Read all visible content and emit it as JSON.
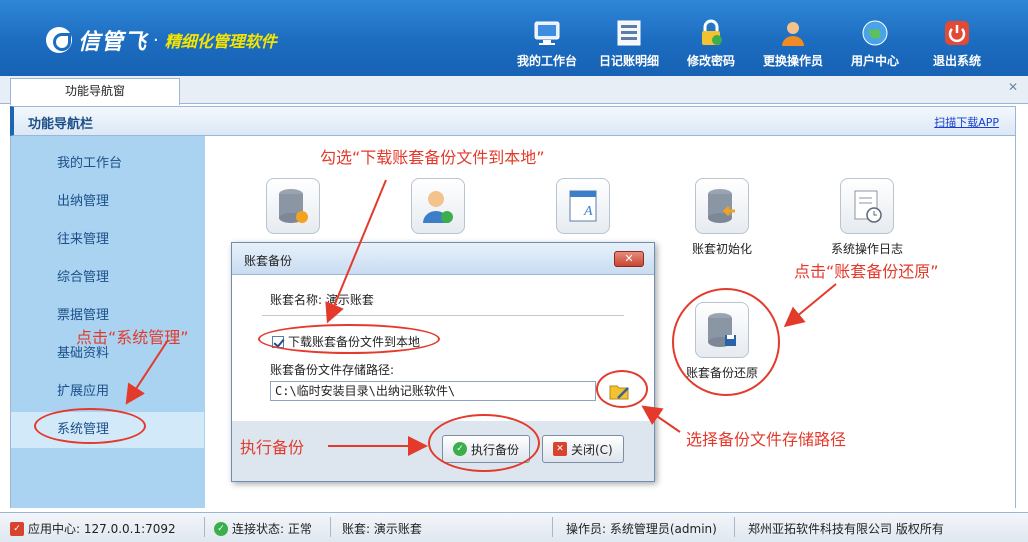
{
  "header": {
    "brand": "信管飞",
    "slogan": "精细化管理软件",
    "nav": [
      {
        "label": "我的工作台",
        "icon": "monitor-icon"
      },
      {
        "label": "日记账明细",
        "icon": "ledger-list-icon"
      },
      {
        "label": "修改密码",
        "icon": "lock-icon"
      },
      {
        "label": "更换操作员",
        "icon": "user-switch-icon"
      },
      {
        "label": "用户中心",
        "icon": "globe-icon"
      },
      {
        "label": "退出系统",
        "icon": "power-icon"
      }
    ]
  },
  "tabs": {
    "active": "功能导航窗"
  },
  "navbar": {
    "title": "功能导航栏",
    "scan_link": "扫描下载APP"
  },
  "sidebar": {
    "items": [
      "我的工作台",
      "出纳管理",
      "往来管理",
      "综合管理",
      "票据管理",
      "基础资料",
      "扩展应用",
      "系统管理"
    ],
    "active": "系统管理"
  },
  "tiles": [
    {
      "label": "账套初始化",
      "icon": "database-arrow-icon"
    },
    {
      "label": "系统操作日志",
      "icon": "log-clock-icon"
    },
    {
      "label": "账套备份还原",
      "icon": "database-restore-icon"
    }
  ],
  "dialog": {
    "title": "账套备份",
    "account_label": "账套名称:",
    "account_value": "演示账套",
    "checkbox_label": "下载账套备份文件到本地",
    "checkbox_checked": true,
    "path_label": "账套备份文件存储路径:",
    "path_value": "C:\\临时安装目录\\出纳记账软件\\",
    "ok_label": "执行备份",
    "cancel_label": "关闭(C)",
    "close_glyph": "✕"
  },
  "annotations": {
    "check_note": "勾选“下载账套备份文件到本地”",
    "restore_note": "点击“账套备份还原”",
    "system_note": "点击“系统管理”",
    "path_note": "选择备份文件存储路径",
    "exec_note": "执行备份"
  },
  "statusbar": {
    "app_center": "应用中心: 127.0.0.1:7092",
    "connection": "连接状态: 正常",
    "account": "账套: 演示账套",
    "operator": "操作员: 系统管理员(admin)",
    "copyright": "郑州亚拓软件科技有限公司 版权所有"
  },
  "colors": {
    "header": "#1c6cc0",
    "accent": "#e33a2c",
    "sidebar": "#a9d3f1",
    "slogan": "#f5e400"
  }
}
